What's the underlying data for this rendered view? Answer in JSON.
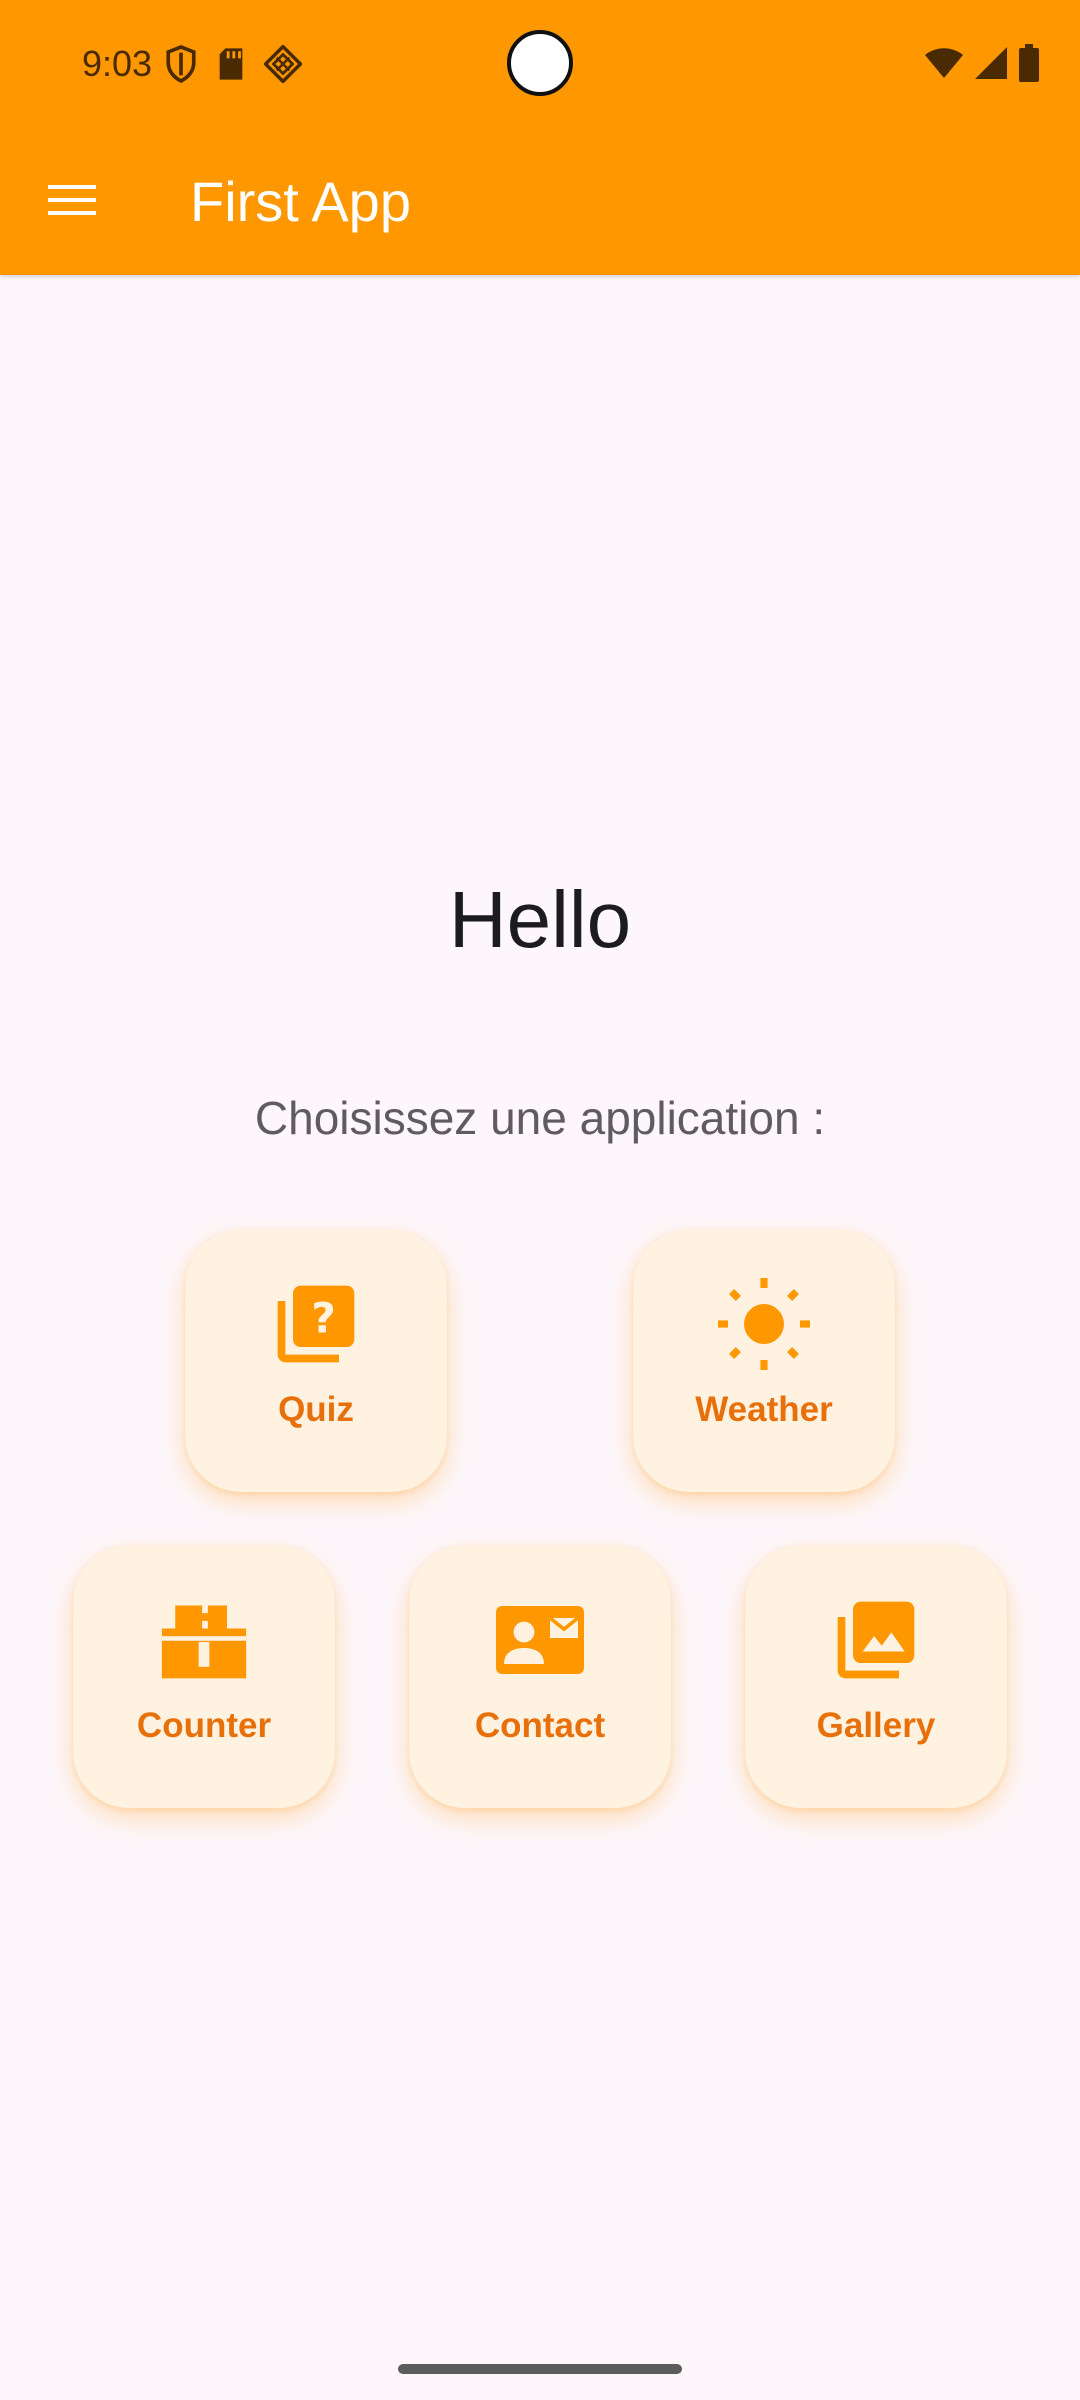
{
  "status_bar": {
    "time": "9:03",
    "left_icons": [
      "shield-icon",
      "sd-card-icon",
      "data-saver-icon"
    ],
    "right_icons": [
      "wifi-icon",
      "signal-icon",
      "battery-icon"
    ]
  },
  "app_bar": {
    "menu_icon": "menu-icon",
    "title": "First App",
    "background_color": "#ff9800"
  },
  "main": {
    "greeting": "Hello",
    "subtitle": "Choisissez une application :",
    "tiles": [
      {
        "label": "Quiz",
        "icon": "quiz-icon"
      },
      {
        "label": "Weather",
        "icon": "sun-icon"
      },
      {
        "label": "Counter",
        "icon": "counter-icon"
      },
      {
        "label": "Contact",
        "icon": "contact-card-icon"
      },
      {
        "label": "Gallery",
        "icon": "photo-library-icon"
      }
    ],
    "tile_icon_color": "#ff9800",
    "tile_label_color": "#e8700b",
    "tile_background": "#fff2e0"
  }
}
